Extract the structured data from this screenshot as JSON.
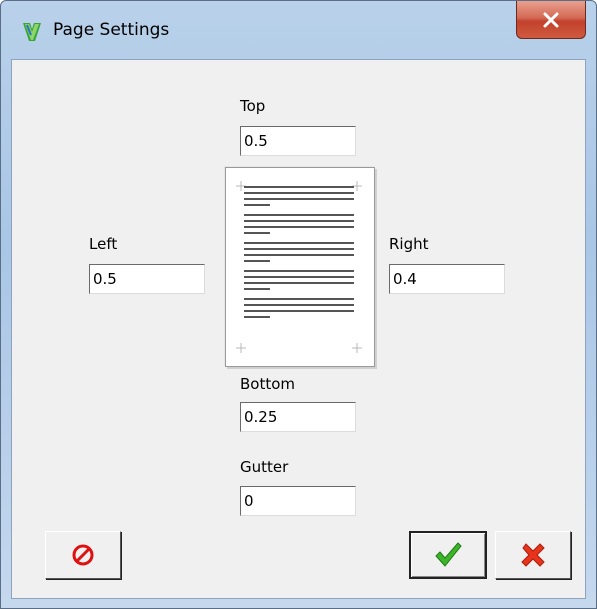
{
  "window": {
    "title": "Page Settings",
    "close_icon": "close-icon",
    "app_icon": "app-icon"
  },
  "margins": {
    "top": {
      "label": "Top",
      "value": "0.5"
    },
    "left": {
      "label": "Left",
      "value": "0.5"
    },
    "right": {
      "label": "Right",
      "value": "0.4"
    },
    "bottom": {
      "label": "Bottom",
      "value": "0.25"
    },
    "gutter": {
      "label": "Gutter",
      "value": "0"
    }
  },
  "buttons": {
    "reset": {
      "icon": "prohibited-icon",
      "color": "#e01010"
    },
    "ok": {
      "icon": "checkmark-icon",
      "color": "#2fa51a"
    },
    "cancel": {
      "icon": "x-mark-icon",
      "color": "#e0301a"
    }
  }
}
